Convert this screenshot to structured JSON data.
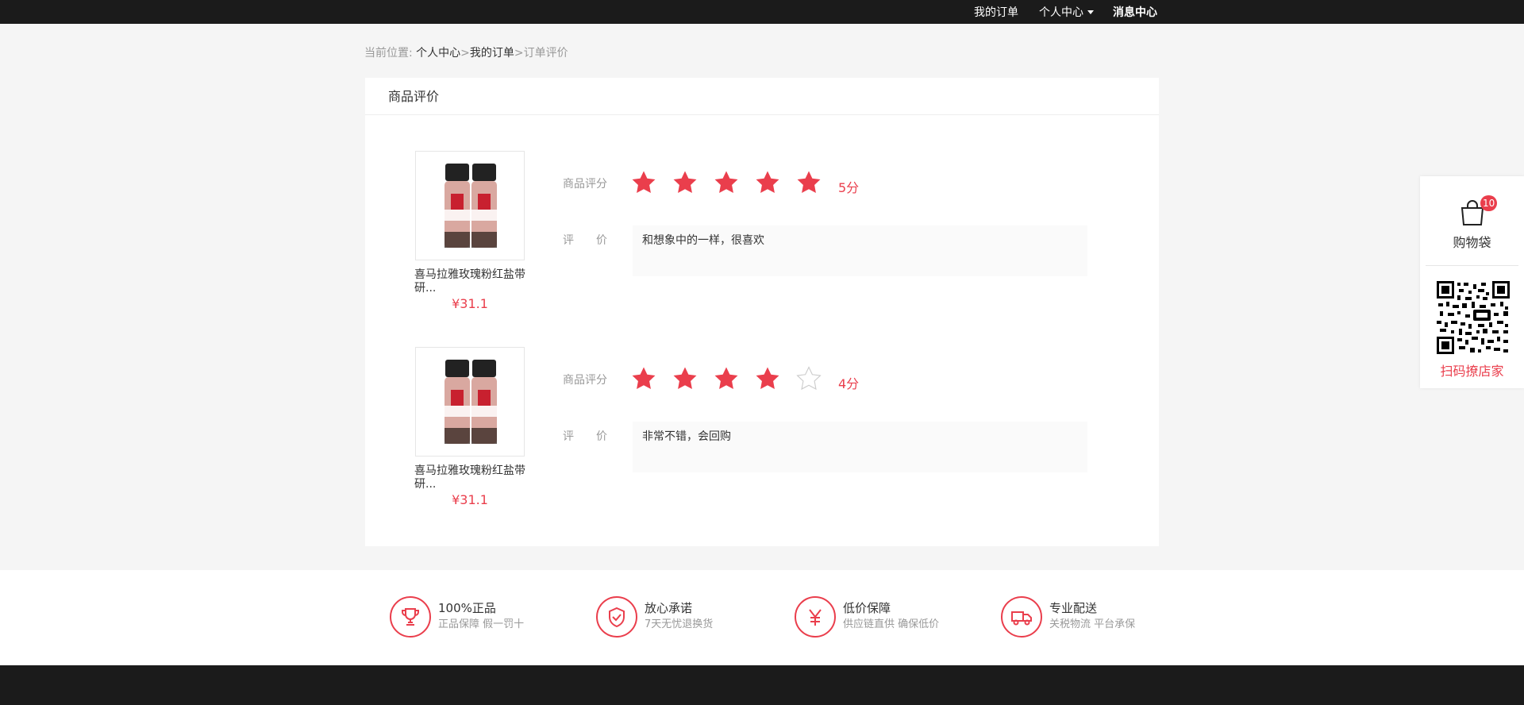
{
  "topbar": {
    "my_orders": "我的订单",
    "personal_center": "个人中心",
    "message_center": "消息中心"
  },
  "breadcrumb": {
    "prefix": "当前位置:",
    "items": [
      "个人中心",
      "我的订单",
      "订单评价"
    ],
    "separator": ">"
  },
  "card": {
    "title": "商品评价"
  },
  "labels": {
    "rating": "商品评分",
    "comment": "评　　价"
  },
  "reviews": [
    {
      "product_name": "喜马拉雅玫瑰粉红盐带研...",
      "price": "¥31.1",
      "stars": 5,
      "score": "5分",
      "comment": "和想象中的一样，很喜欢"
    },
    {
      "product_name": "喜马拉雅玫瑰粉红盐带研...",
      "price": "¥31.1",
      "stars": 4,
      "score": "4分",
      "comment": "非常不错，会回购"
    }
  ],
  "features": [
    {
      "icon": "trophy-icon",
      "title": "100%正品",
      "subtitle": "正品保障  假一罚十"
    },
    {
      "icon": "shield-check-icon",
      "title": "放心承诺",
      "subtitle": "7天无忧退换货"
    },
    {
      "icon": "yen-icon",
      "title": "低价保障",
      "subtitle": "供应链直供  确保低价"
    },
    {
      "icon": "truck-icon",
      "title": "专业配送",
      "subtitle": "关税物流 平台承保"
    }
  ],
  "sidebar": {
    "cart_label": "购物袋",
    "cart_count": "10",
    "scan_label": "扫码撩店家"
  },
  "colors": {
    "accent": "#ea3e4c",
    "topbar": "#1b1b1b",
    "background": "#f5f5f5"
  }
}
